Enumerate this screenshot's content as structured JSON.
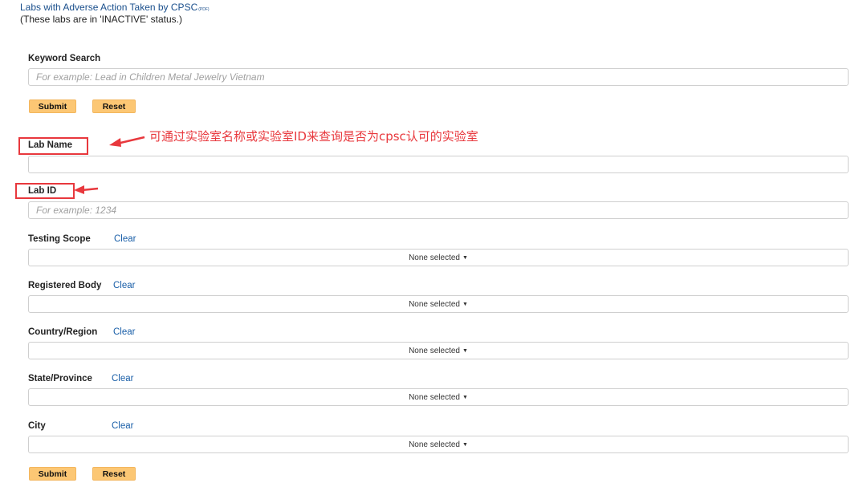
{
  "header": {
    "link_text": "Labs with Adverse Action Taken by CPSC",
    "pdf_tag": "(PDF)",
    "note": "(These labs are in 'INACTIVE' status.)"
  },
  "keyword": {
    "label": "Keyword Search",
    "placeholder": "For example: Lead in Children Metal Jewelry Vietnam"
  },
  "buttons": {
    "submit": "Submit",
    "reset": "Reset"
  },
  "lab_name": {
    "label": "Lab Name",
    "placeholder": ""
  },
  "lab_id": {
    "label": "Lab ID",
    "placeholder": "For example: 1234"
  },
  "filters": [
    {
      "label": "Testing Scope",
      "clear": "Clear",
      "value": "None selected"
    },
    {
      "label": "Registered Body",
      "clear": "Clear",
      "value": "None selected"
    },
    {
      "label": "Country/Region",
      "clear": "Clear",
      "value": "None selected"
    },
    {
      "label": "State/Province",
      "clear": "Clear",
      "value": "None selected"
    },
    {
      "label": "City",
      "clear": "Clear",
      "value": "None selected"
    }
  ],
  "annotation": {
    "text": "可通过实验室名称或实验室ID来查询是否为cpsc认可的实验室",
    "color": "#e8383d"
  },
  "colors": {
    "button": "#fcc774",
    "link": "#1a4f8c"
  }
}
